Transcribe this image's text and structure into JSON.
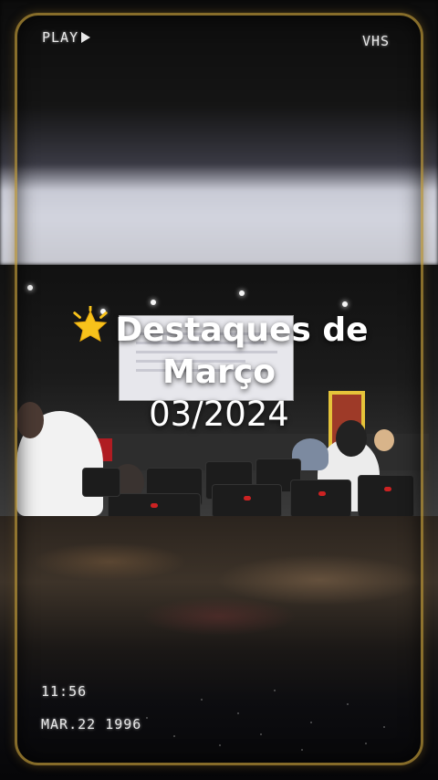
{
  "overlay": {
    "play_label": "PLAY",
    "format_label": "VHS",
    "time": "11:56",
    "date": "MAR.22 1996"
  },
  "title": {
    "emoji_icon": "glowing-star-icon",
    "line1": "Destaques de",
    "line2": "Março",
    "date": "03/2024"
  },
  "colors": {
    "frame": "#b08d34",
    "text": "#ffffff",
    "star": "#f7c21b"
  }
}
